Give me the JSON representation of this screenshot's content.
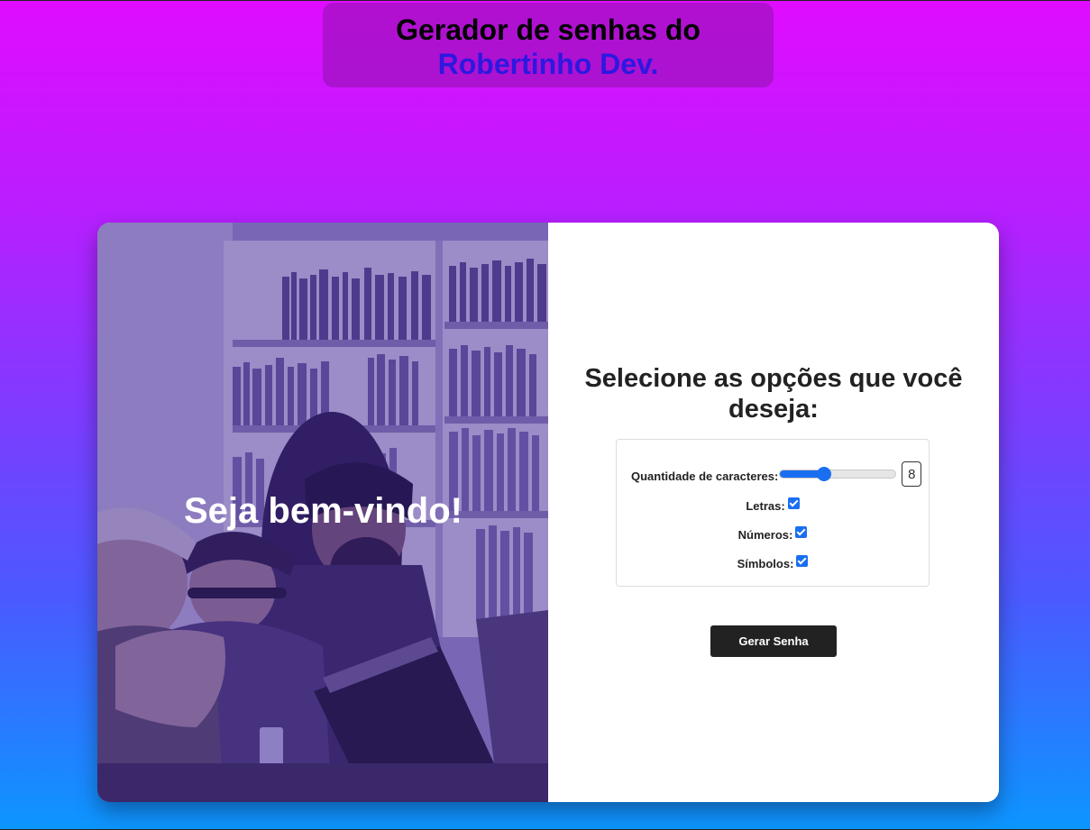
{
  "header": {
    "title_line1": "Gerador de senhas do",
    "title_line2": "Robertinho Dev."
  },
  "hero": {
    "welcome_text": "Seja bem-vindo!"
  },
  "options": {
    "heading": "Selecione as opções que você deseja:",
    "length_label": "Quantidade de caracteres:",
    "length_value": "8",
    "length_slider_fraction": 0.38,
    "letters_label": "Letras:",
    "letters_checked": true,
    "numbers_label": "Números:",
    "numbers_checked": true,
    "symbols_label": "Símbolos:",
    "symbols_checked": true
  },
  "actions": {
    "generate_label": "Gerar Senha"
  },
  "colors": {
    "gradient_top": "#e00cff",
    "gradient_bottom": "#0c96ff",
    "accent": "#1a6ff0",
    "button_bg": "#222222"
  }
}
